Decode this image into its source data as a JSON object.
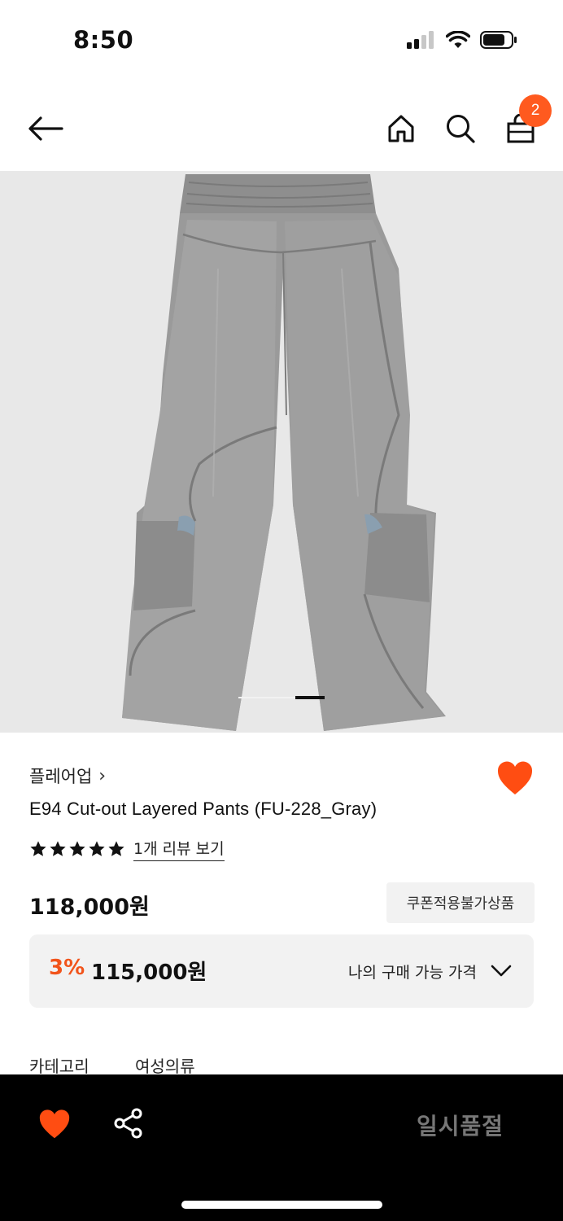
{
  "status_bar": {
    "time": "8:50"
  },
  "header": {
    "cart_count": "2"
  },
  "product": {
    "brand": "플레어업",
    "brand_chevron": "›",
    "title": "E94 Cut-out Layered Pants (FU-228_Gray)",
    "rating_stars": 5,
    "review_link": "1개 리뷰 보기",
    "price": "118,000원",
    "coupon_badge": "쿠폰적용불가상품",
    "discount_rate": "3%",
    "discount_price": "115,000원",
    "my_price_label": "나의 구매 가능 가격",
    "category_label": "카테고리",
    "category_value": "여성의류"
  },
  "carousel": {
    "active_index": 1,
    "total": 2
  },
  "bottom_bar": {
    "sold_out_label": "일시품절"
  },
  "colors": {
    "accent": "#ff5a1f",
    "discount": "#f2541b",
    "bottom_bar": "#000000",
    "sold_out_text": "#777777"
  }
}
